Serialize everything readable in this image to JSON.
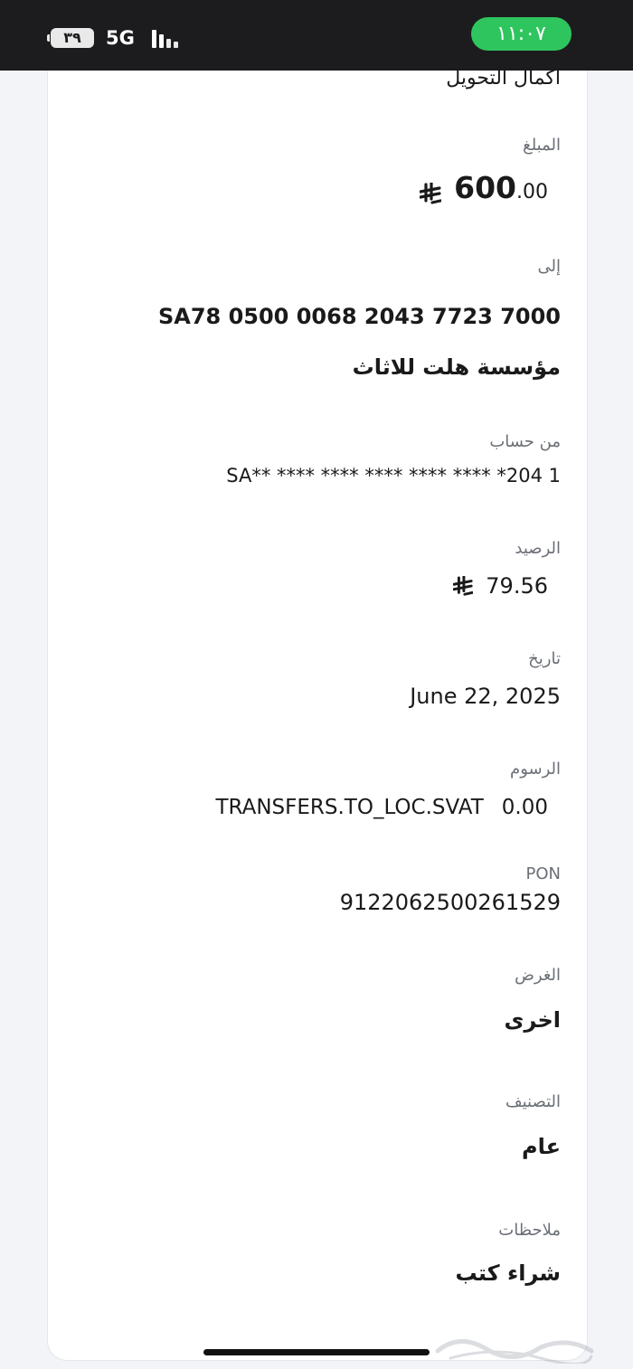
{
  "status": {
    "time": "١١:٠٧",
    "battery": "٣٩",
    "network": "5G"
  },
  "page": {
    "title": "اكمال التحويل"
  },
  "amount": {
    "label": "المبلغ",
    "integer": "600",
    "decimal": ".00",
    "currency_icon": "saudi-riyal-icon"
  },
  "recipient": {
    "label": "إلى",
    "iban": "SA78 0500 0068 2043 7723 7000",
    "name": "مؤسسة هلت للاثاث"
  },
  "from_account": {
    "label": "من حساب",
    "value": "SA** **** **** **** **** **** *204 1"
  },
  "balance": {
    "label": "الرصيد",
    "value": "79.56",
    "currency_icon": "saudi-riyal-icon"
  },
  "date": {
    "label": "تاريخ",
    "value": "June 22, 2025"
  },
  "fees": {
    "label": "الرسوم",
    "amount": "0.00",
    "code": "TRANSFERS.TO_LOC.SVAT"
  },
  "pon": {
    "label": "PON",
    "value": "9122062500261529"
  },
  "purpose": {
    "label": "الغرض",
    "value": "اخرى"
  },
  "category": {
    "label": "التصنيف",
    "value": "عام"
  },
  "notes": {
    "label": "ملاحظات",
    "value": "شراء كتب"
  },
  "colors": {
    "status_bar": "#1c1c1e",
    "time_pill": "#2fc55e",
    "label": "#6b6f76",
    "value": "#1a1a1a"
  }
}
